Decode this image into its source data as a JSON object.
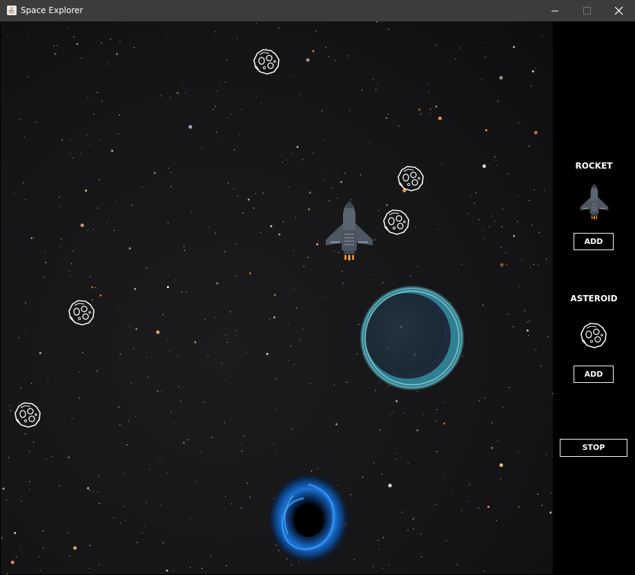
{
  "window": {
    "title": "Space Explorer"
  },
  "sidebar": {
    "rocket": {
      "label": "ROCKET",
      "add_label": "ADD"
    },
    "asteroid": {
      "label": "ASTEROID",
      "add_label": "ADD"
    },
    "stop_label": "STOP"
  },
  "scene": {
    "background": "starfield",
    "objects": [
      "rocket",
      "asteroid",
      "asteroid",
      "asteroid",
      "asteroid",
      "asteroid",
      "planet",
      "black-hole"
    ]
  },
  "colors": {
    "titlebar": "#3c3c3c",
    "panel": "#000000",
    "space": "#151517",
    "planet_glow": "#5fc6d6",
    "black_hole": "#1a6fd1"
  }
}
